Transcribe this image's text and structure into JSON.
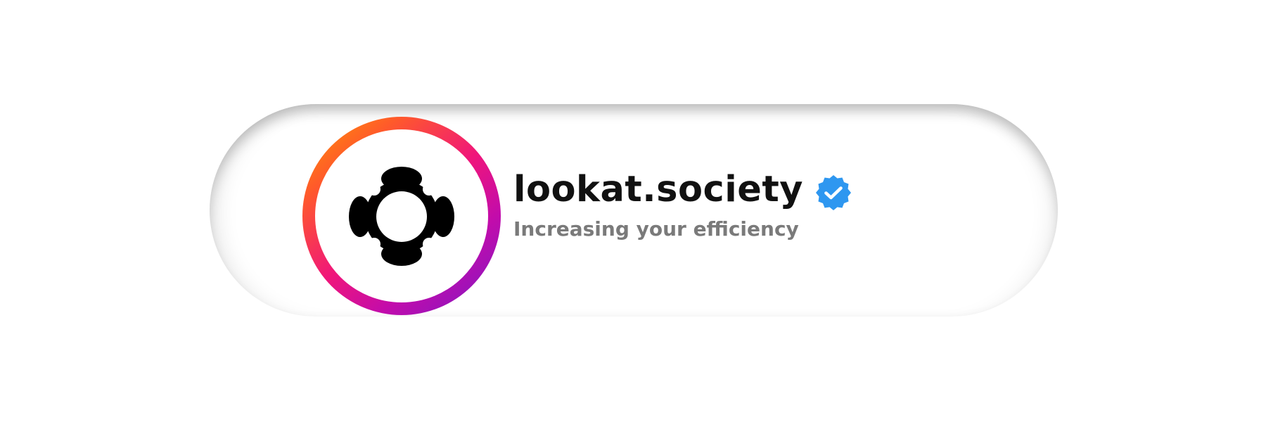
{
  "profile": {
    "username": "lookat.society",
    "tagline": "Increasing your efficiency",
    "verified": true,
    "avatar_icon": "lookat-society-logo",
    "verified_icon": "verified-badge-icon"
  },
  "colors": {
    "ring_gradient": [
      "#ff9a00",
      "#ff5a2a",
      "#f0167a",
      "#c20cab",
      "#7a18c6"
    ],
    "verified_badge": "#2e97f0",
    "username_text": "#111111",
    "tagline_text": "#7a7a7a",
    "background": "#ffffff"
  }
}
